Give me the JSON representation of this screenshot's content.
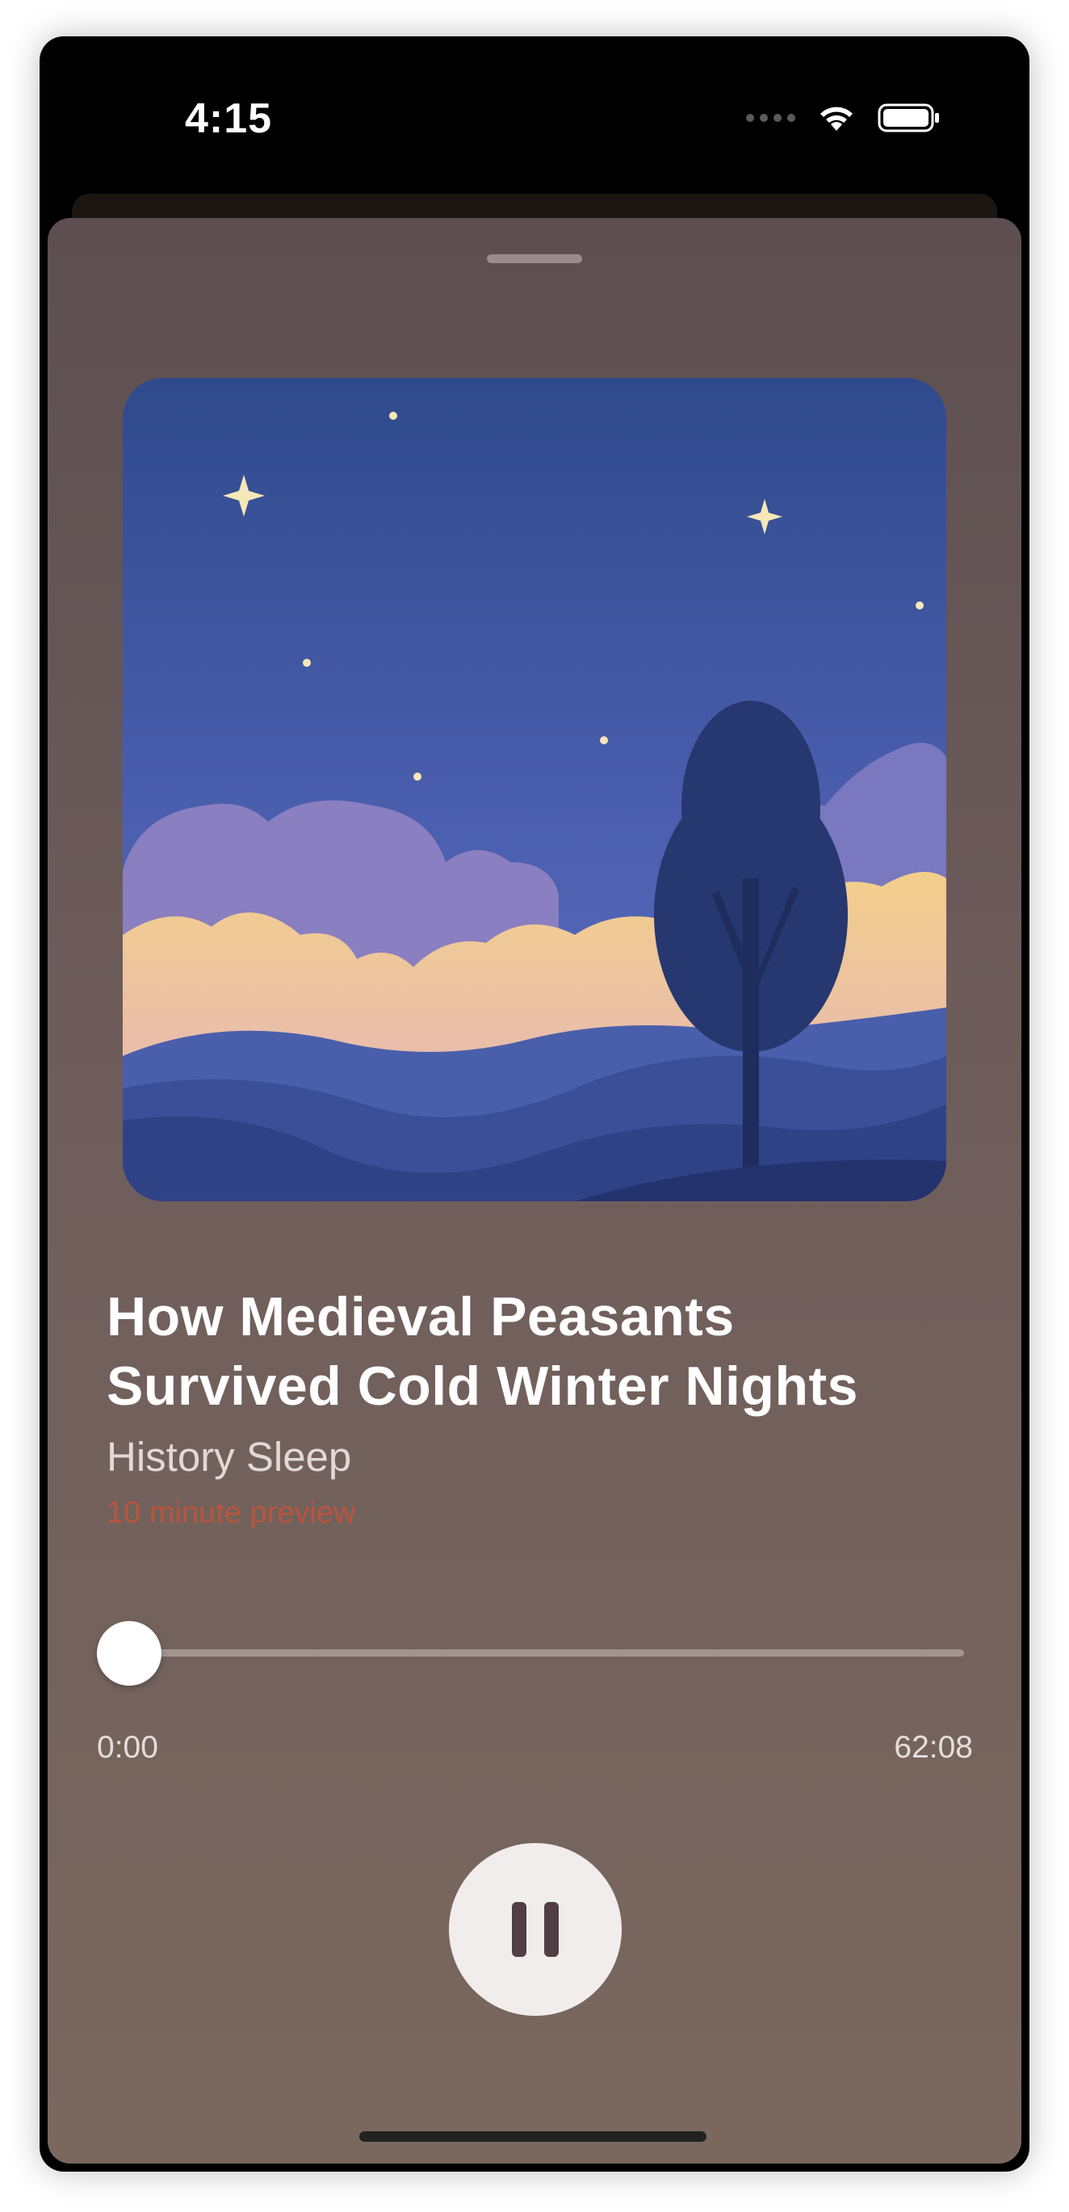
{
  "status_bar": {
    "time": "4:15",
    "wifi_icon": "wifi-icon",
    "battery_icon": "battery-icon"
  },
  "player": {
    "artwork_description_icon": "night-landscape-artwork",
    "title": "How Medieval Peasants Survived Cold Winter Nights",
    "show": "History Sleep",
    "preview_label": "10 minute preview",
    "progress": 0,
    "elapsed": "0:00",
    "duration": "62:08",
    "state": "playing",
    "control_icon": "pause-icon"
  },
  "colors": {
    "accent": "#b9553d",
    "sheet_top": "#5d4e51",
    "sheet_bottom": "#7a685f",
    "play_button_bg": "#f1edec",
    "pause_glyph": "#4f3e44"
  }
}
